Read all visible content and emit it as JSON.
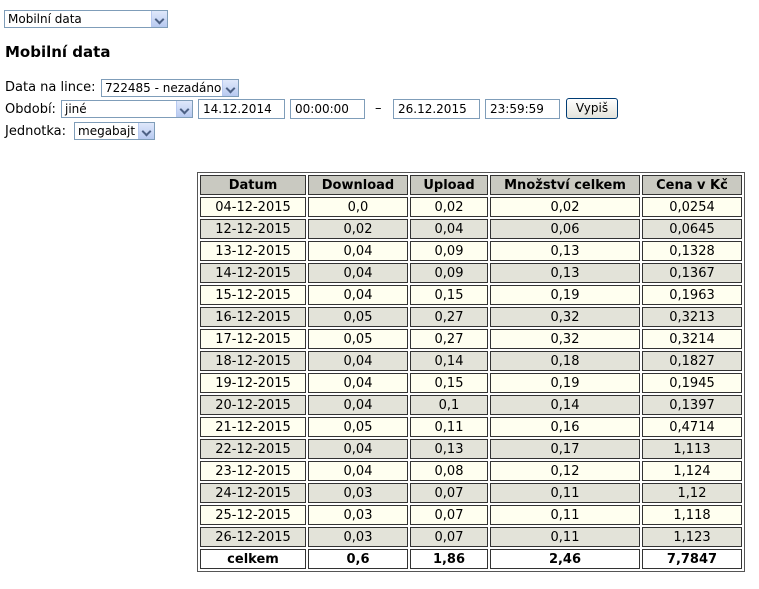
{
  "top_select": {
    "value": "Mobilní data"
  },
  "title": "Mobilní data",
  "form": {
    "line_label": "Data na lince:",
    "line_value": "722485 - nezadáno",
    "period_label": "Období:",
    "period_value": "jiné",
    "date_from": "14.12.2014",
    "time_from": "00:00:00",
    "dash": "–",
    "date_to": "26.12.2015",
    "time_to": "23:59:59",
    "submit_label": "Vypiš",
    "unit_label": "Jednotka:",
    "unit_value": "megabajt"
  },
  "table": {
    "headers": [
      "Datum",
      "Download",
      "Upload",
      "Množství celkem",
      "Cena v Kč"
    ],
    "rows": [
      [
        "04-12-2015",
        "0,0",
        "0,02",
        "0,02",
        "0,0254"
      ],
      [
        "12-12-2015",
        "0,02",
        "0,04",
        "0,06",
        "0,0645"
      ],
      [
        "13-12-2015",
        "0,04",
        "0,09",
        "0,13",
        "0,1328"
      ],
      [
        "14-12-2015",
        "0,04",
        "0,09",
        "0,13",
        "0,1367"
      ],
      [
        "15-12-2015",
        "0,04",
        "0,15",
        "0,19",
        "0,1963"
      ],
      [
        "16-12-2015",
        "0,05",
        "0,27",
        "0,32",
        "0,3213"
      ],
      [
        "17-12-2015",
        "0,05",
        "0,27",
        "0,32",
        "0,3214"
      ],
      [
        "18-12-2015",
        "0,04",
        "0,14",
        "0,18",
        "0,1827"
      ],
      [
        "19-12-2015",
        "0,04",
        "0,15",
        "0,19",
        "0,1945"
      ],
      [
        "20-12-2015",
        "0,04",
        "0,1",
        "0,14",
        "0,1397"
      ],
      [
        "21-12-2015",
        "0,05",
        "0,11",
        "0,16",
        "0,4714"
      ],
      [
        "22-12-2015",
        "0,04",
        "0,13",
        "0,17",
        "1,113"
      ],
      [
        "23-12-2015",
        "0,04",
        "0,08",
        "0,12",
        "1,124"
      ],
      [
        "24-12-2015",
        "0,03",
        "0,07",
        "0,11",
        "1,12"
      ],
      [
        "25-12-2015",
        "0,03",
        "0,07",
        "0,11",
        "1,118"
      ],
      [
        "26-12-2015",
        "0,03",
        "0,07",
        "0,11",
        "1,123"
      ]
    ],
    "total": [
      "celkem",
      "0,6",
      "1,86",
      "2,46",
      "7,7847"
    ]
  }
}
